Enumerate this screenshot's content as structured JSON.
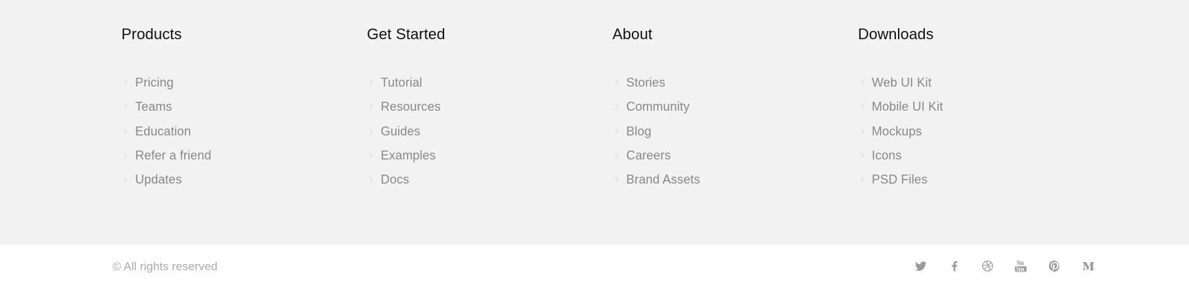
{
  "columns": [
    {
      "title": "Products",
      "links": [
        "Pricing",
        "Teams",
        "Education",
        "Refer a friend",
        "Updates"
      ]
    },
    {
      "title": "Get Started",
      "links": [
        "Tutorial",
        "Resources",
        "Guides",
        "Examples",
        "Docs"
      ]
    },
    {
      "title": "About",
      "links": [
        "Stories",
        "Community",
        "Blog",
        "Careers",
        "Brand Assets"
      ]
    },
    {
      "title": "Downloads",
      "links": [
        "Web UI Kit",
        "Mobile UI Kit",
        "Mockups",
        "Icons",
        "PSD Files"
      ]
    }
  ],
  "bottom": {
    "copyright": "© All rights reserved",
    "social": [
      "twitter-icon",
      "facebook-icon",
      "dribbble-icon",
      "youtube-icon",
      "pinterest-icon",
      "medium-icon"
    ]
  },
  "colors": {
    "background": "#f2f2f2",
    "heading": "#111111",
    "link": "#888888",
    "icon": "#9a9a9a"
  }
}
